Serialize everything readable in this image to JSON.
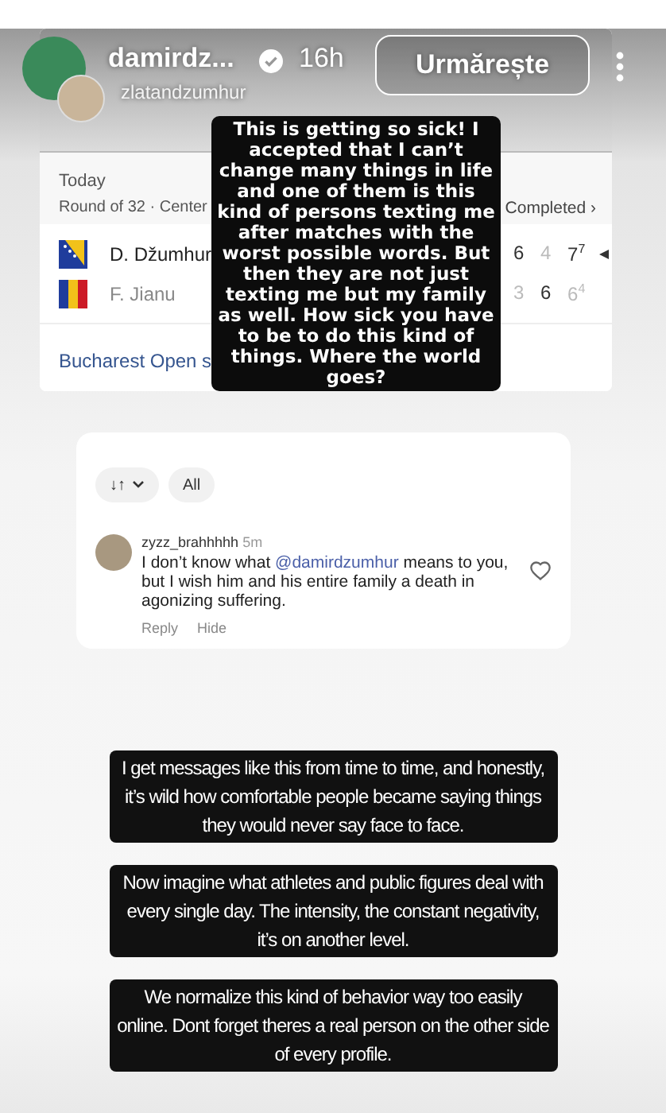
{
  "story_header": {
    "username": "damirdz...",
    "verified": true,
    "time": "16h",
    "follow_button": "Urmărește",
    "collab_username": "zlatandzumhur"
  },
  "match_screenshot": {
    "date": "Today",
    "round": "Round of 32 · Center",
    "status": "Completed ›",
    "players": [
      {
        "name": "D. Džumhur",
        "kind": "bosnia",
        "winner": true,
        "sets": [
          {
            "score": "6",
            "won": true
          },
          {
            "score": "4",
            "won": false
          },
          {
            "score": "7$^{7}$",
            "won": true
          }
        ],
        "serving": true
      },
      {
        "name": "F. Jianu",
        "kind": "romania",
        "winner": false,
        "sets": [
          {
            "score": "3",
            "won": false
          },
          {
            "score": "6",
            "won": true
          },
          {
            "score": "6$^{4}$",
            "won": false
          }
        ],
        "serving": false
      }
    ],
    "tournament_link": "Bucharest Open s"
  },
  "comment_screenshot": {
    "chips": [
      {
        "kind": "sort",
        "label": "↓↑"
      },
      {
        "kind": "filter",
        "label": "All"
      }
    ],
    "comment": {
      "username": "zyzz_brahhhhh",
      "time": "5m",
      "text_before": "I don’t know what ",
      "mention": "@damirdzumhur",
      "text_after": " means to you, but I wish him and his entire family a death in agonizing suffering.",
      "liked": false,
      "actions": [
        "Reply",
        "Hide"
      ]
    }
  },
  "overlay_text": "This is getting so sick! I accepted that I can’t change many things in life and one of them is this kind of persons texting me after matches with the worst possible words. But then they are not just texting me but my family as well. How sick you have to be to do this kind of things. Where the world goes?",
  "captions": [
    "I get messages like this from time to time, and honestly, it’s wild how comfortable people became saying things they would never say face to face.",
    "Now imagine what athletes and public figures deal with every single day. The intensity, the constant negativity, it’s on another level.",
    "We normalize this kind of behavior way too easily online. Dont forget theres a real person on the other side of every profile."
  ]
}
